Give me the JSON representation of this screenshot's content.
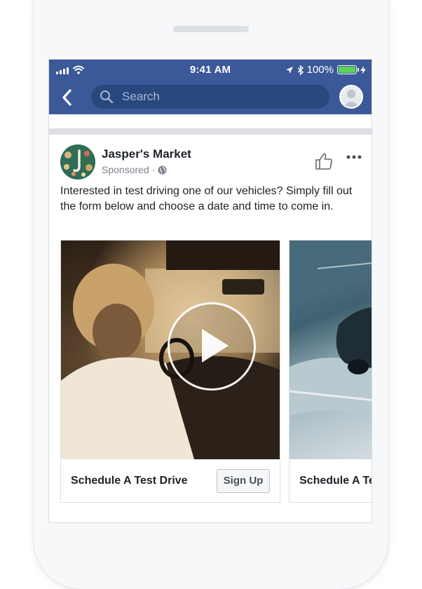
{
  "status_bar": {
    "time": "9:41 AM",
    "battery_percent": "100%",
    "signal_icon": "signal-bars-icon",
    "wifi_icon": "wifi-icon",
    "location_icon": "location-arrow-icon",
    "bluetooth_icon": "bluetooth-icon",
    "charging_icon": "lightning-icon"
  },
  "nav": {
    "back_icon": "chevron-left-icon",
    "search_placeholder": "Search",
    "search_icon": "search-icon",
    "avatar_icon": "profile-avatar-icon"
  },
  "post": {
    "page_name": "Jasper's Market",
    "sponsored_label": "Sponsored",
    "separator": "·",
    "audience_icon": "globe-icon",
    "like_icon": "thumbs-up-icon",
    "more_icon": "more-dots-icon",
    "text": "Interested in test driving one of our vehicles? Simply fill out the form below and choose a date and time to come in.",
    "carousel": [
      {
        "title": "Schedule A Test Drive",
        "button_label": "Sign Up",
        "media": "video",
        "play_icon": "play-icon"
      },
      {
        "title": "Schedule A Test Drive",
        "media": "image"
      }
    ]
  },
  "colors": {
    "facebook_blue": "#3b5998",
    "search_bg": "#29487d",
    "battery_green": "#5ad15a"
  }
}
